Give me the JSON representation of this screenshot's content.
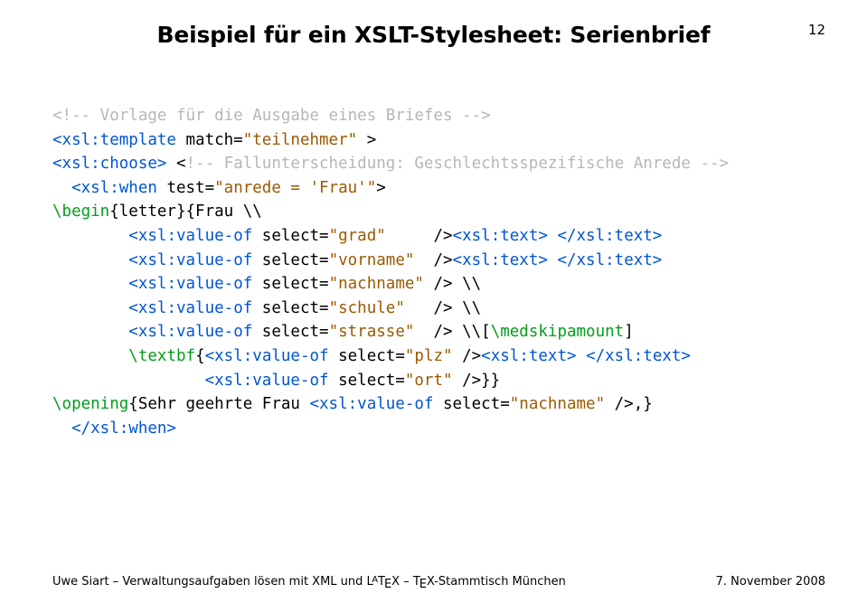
{
  "header": {
    "title": "Beispiel für ein XSLT-Stylesheet: Serienbrief",
    "page_number": "12"
  },
  "code": {
    "l01_a": "<!-- Vorlage für die Ausgabe eines Briefes -->",
    "l02_a": "<xsl:template",
    "l02_b": " match=",
    "l02_c": "\"teilnehmer\"",
    "l02_d": " >",
    "l03_a": "<xsl:choose>",
    "l03_b": " <",
    "l03_c": "!-- Fallunterscheidung: Geschlechtsspezifische Anrede -->",
    "l04_a": "  ",
    "l04_b": "<xsl:when",
    "l04_c": " test=",
    "l04_d": "\"anrede = 'Frau'\"",
    "l04_e": ">",
    "l05_a": "\\begin",
    "l05_b": "{letter}{Frau \\\\",
    "l06_a": "        ",
    "l06_b": "<xsl:value-of",
    "l06_c": " select=",
    "l06_d": "\"grad\"",
    "l06_e": "     />",
    "l06_f": "<xsl:text>",
    "l06_g": " ",
    "l06_h": "</xsl:text>",
    "l07_a": "        ",
    "l07_b": "<xsl:value-of",
    "l07_c": " select=",
    "l07_d": "\"vorname\"",
    "l07_e": "  />",
    "l07_f": "<xsl:text>",
    "l07_g": " ",
    "l07_h": "</xsl:text>",
    "l08_a": "        ",
    "l08_b": "<xsl:value-of",
    "l08_c": " select=",
    "l08_d": "\"nachname\"",
    "l08_e": " /> \\\\",
    "l09_a": "        ",
    "l09_b": "<xsl:value-of",
    "l09_c": " select=",
    "l09_d": "\"schule\"",
    "l09_e": "   /> \\\\",
    "l10_a": "        ",
    "l10_b": "<xsl:value-of",
    "l10_c": " select=",
    "l10_d": "\"strasse\"",
    "l10_e": "  /> \\\\[",
    "l10_f": "\\medskipamount",
    "l10_g": "]",
    "l11_a": "        ",
    "l11_b": "\\textbf",
    "l11_c": "{",
    "l11_d": "<xsl:value-of",
    "l11_e": " select=",
    "l11_f": "\"plz\"",
    "l11_g": " />",
    "l11_h": "<xsl:text>",
    "l11_i": " ",
    "l11_j": "</xsl:text>",
    "l12_a": "                ",
    "l12_b": "<xsl:value-of",
    "l12_c": " select=",
    "l12_d": "\"ort\"",
    "l12_e": " />}}",
    "l13_a": "\\opening",
    "l13_b": "{Sehr geehrte Frau ",
    "l13_c": "<xsl:value-of",
    "l13_d": " select=",
    "l13_e": "\"nachname\"",
    "l13_f": " />,}",
    "l14_a": "  ",
    "l14_b": "</xsl:when>"
  },
  "footer": {
    "author": "Uwe Siart – Verwaltungsaufgaben lösen mit XML und ",
    "latex_part": "L",
    "a_part": "A",
    "tex_part1": "T",
    "e_part": "E",
    "tex_part2": "X – ",
    "tex2_t": "T",
    "tex2_e": "E",
    "tex2_x": "X-Stammtisch München",
    "date": "7. November 2008"
  }
}
